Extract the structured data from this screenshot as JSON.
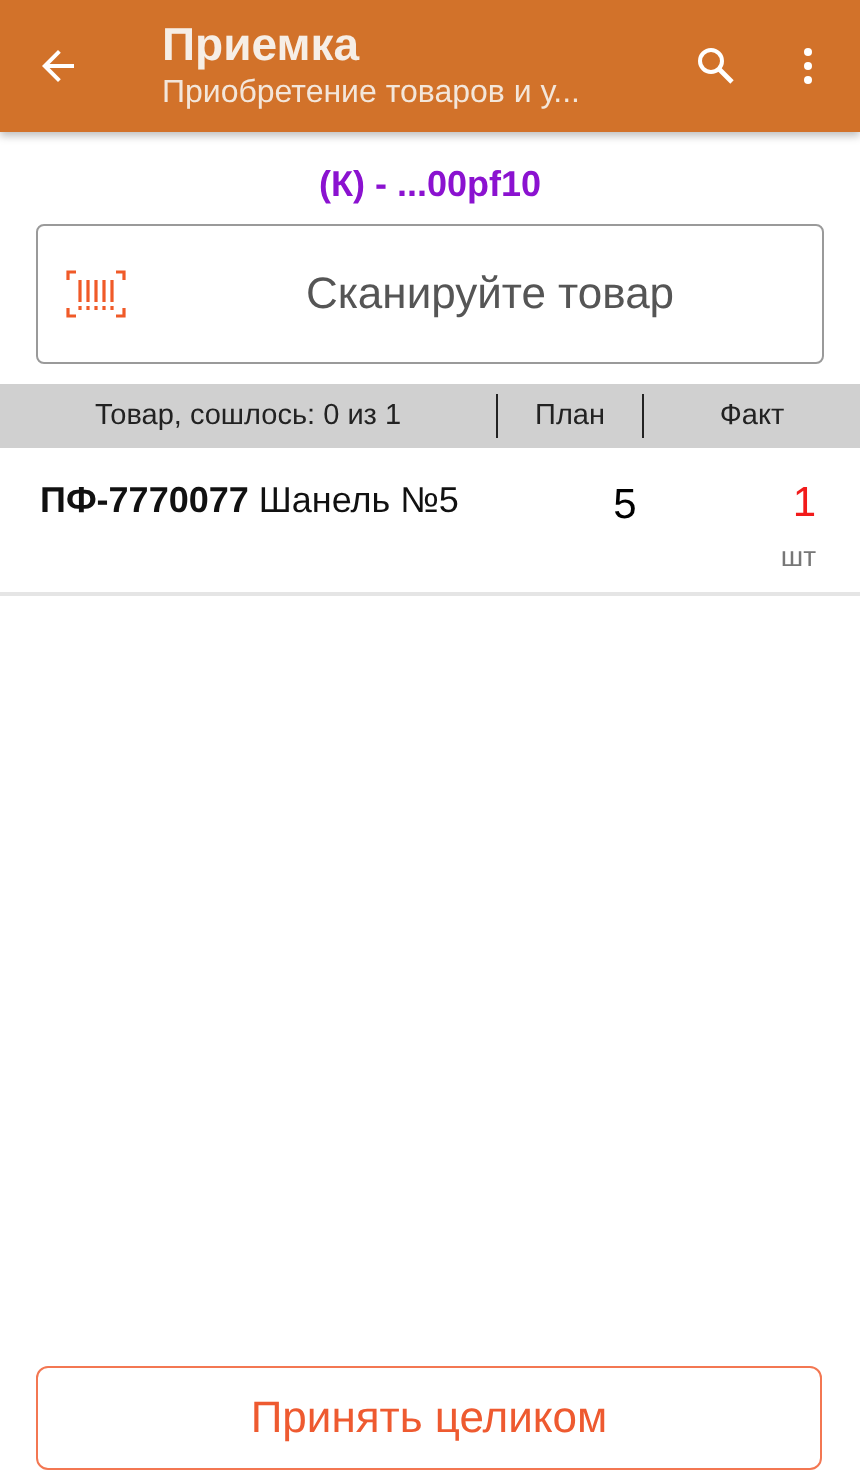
{
  "toolbar": {
    "title": "Приемка",
    "subtitle": "Приобретение товаров и у..."
  },
  "document": "(К) - ...00pf10",
  "scan_field": {
    "placeholder": "Сканируйте товар"
  },
  "table": {
    "columns": [
      "Товар, сошлось: 0 из 1",
      "План",
      "Факт"
    ],
    "rows": [
      {
        "item": "**ПФ-7770077** Шанель №5",
        "plan": "5",
        "fact": "1",
        "unit": "шт"
      }
    ]
  },
  "button": "Принять целиком"
}
